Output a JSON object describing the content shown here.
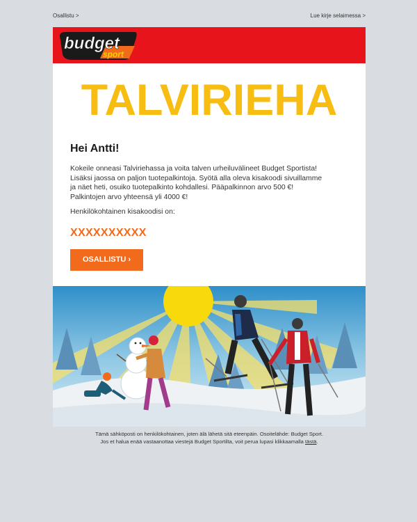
{
  "top_links": {
    "participate": "Osallistu >",
    "view_in_browser": "Lue kirje selaimessa >"
  },
  "brand": {
    "logo_word": "budget",
    "logo_sub": "sport",
    "colors": {
      "banner_red": "#e8141c",
      "headline_yellow": "#f7bd13",
      "accent_orange": "#f26a1b"
    }
  },
  "headline": "TALVIRIEHA",
  "greeting": "Hei Antti!",
  "body_lines": [
    "Kokeile onneasi Talviriehassa ja voita talven urheiluvälineet Budget Sportista!",
    "Lisäksi jaossa on paljon tuotepalkintoja. Syötä alla oleva kisakoodi sivuillamme",
    "ja näet heti, osuiko tuotepalkinto kohdallesi. Pääpalkinnon arvo 500 €!",
    "Palkintojen arvo yhteensä yli 4000 €!"
  ],
  "code_label": "Henkilökohtainen kisakoodisi on:",
  "code": "XXXXXXXXXX",
  "cta_label": "OSALLISTU ›",
  "illustration": {
    "subjects": [
      "sun",
      "snowman",
      "child-crawling",
      "child-standing",
      "skier-dark-jacket",
      "skier-red-jacket",
      "snowy-trees"
    ]
  },
  "footer": {
    "line1": "Tämä sähköposti on henkilökohtainen, joten älä lähetä sitä eteenpäin. Osoitelähde: Budget Sport.",
    "line2_prefix": "Jos et halua enää vastaanottaa viestejä Budget Sportilta, voit perua lupasi klikkaamalla",
    "unsubscribe_link": "tästä",
    "line2_suffix": "."
  }
}
